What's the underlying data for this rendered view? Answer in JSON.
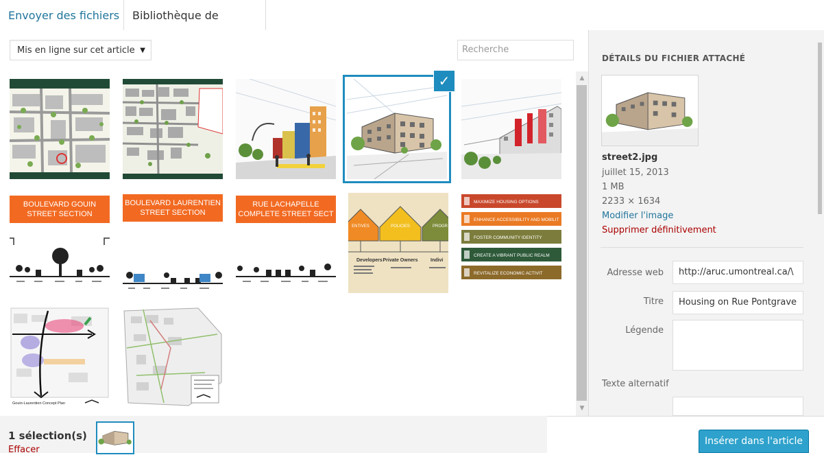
{
  "tabs": [
    {
      "label": "Envoyer des fichiers"
    },
    {
      "label": "Bibliothèque de médias"
    }
  ],
  "toolbar": {
    "filter_label": "Mis en ligne sur cet article",
    "search_placeholder": "Recherche"
  },
  "grid": {
    "items": [
      {
        "alt": "site plan map green"
      },
      {
        "alt": "site plan map aerial"
      },
      {
        "alt": "street sketch perspective"
      },
      {
        "alt": "street2 housing sketch",
        "selected": true
      },
      {
        "alt": "street red facade sketch"
      },
      {
        "heading": "BOULEVARD GOUIN STREET SECTION"
      },
      {
        "heading": "BOULEVARD LAURENTIEN STREET SECTION"
      },
      {
        "heading": "RUE LACHAPELLE COMPLETE STREET SECT"
      },
      {
        "alt": "houses diagram",
        "labels": [
          "Developers",
          "Private Owners",
          "Indivi"
        ],
        "tags": [
          "ENTIVES",
          "POLICIES",
          "PROGR"
        ]
      },
      {
        "alt": "goals list",
        "lines": [
          "MAXIMIZE HOUSING OPTIONS",
          "ENHANCE ACCESSIBILITY AND MOBILIT",
          "FOSTER COMMUNITY IDENTITY",
          "CREATE A VIBRANT PUBLIC REALM",
          "REVITALIZE ECONOMIC ACTIVIT"
        ]
      },
      {
        "alt": "concept plan",
        "caption": "Gouin-Laurentien Concept Plan"
      },
      {
        "alt": "district map"
      }
    ]
  },
  "sidebar": {
    "title": "DÉTAILS DU FICHIER ATTACHÉ",
    "filename": "street2.jpg",
    "date": "juillet 15, 2013",
    "size": "1 MB",
    "dimensions": "2233 × 1634",
    "edit_link": "Modifier l'image",
    "delete_link": "Supprimer définitivement",
    "fields": {
      "url_label": "Adresse web",
      "url_value": "http://aruc.umontreal.ca/\\",
      "title_label": "Titre",
      "title_value": "Housing on Rue Pontgrave",
      "caption_label": "Légende",
      "caption_value": "",
      "alt_label": "Texte alternatif",
      "alt_value": ""
    }
  },
  "footer": {
    "count": "1 sélection(s)",
    "clear": "Effacer",
    "insert_button": "Insérer dans l'article"
  },
  "colors": {
    "accent": "#1e8cbe",
    "link": "#21759b",
    "danger": "#a00",
    "button": "#2ea2cc",
    "orange_banner": "#f26a22"
  }
}
